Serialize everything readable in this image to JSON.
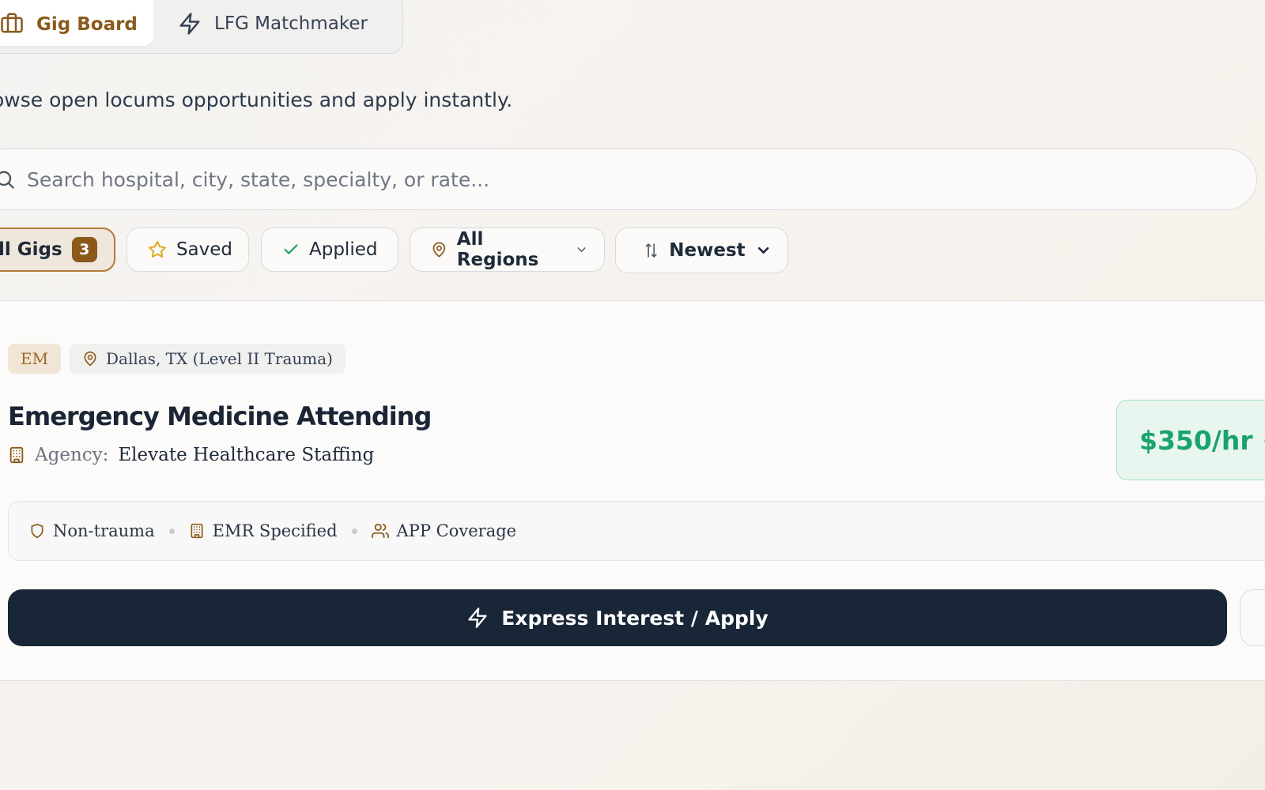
{
  "tabs": [
    {
      "label": "Gig Board",
      "icon": "briefcase-icon"
    },
    {
      "label": "LFG Matchmaker",
      "icon": "lightning-icon"
    }
  ],
  "subtitle": "owse open locums opportunities and apply instantly.",
  "search": {
    "placeholder": "Search hospital, city, state, specialty, or rate..."
  },
  "filters": {
    "all": {
      "label": "ll Gigs",
      "count": "3"
    },
    "saved": {
      "label": "Saved"
    },
    "applied": {
      "label": "Applied"
    },
    "region": {
      "label": "All Regions"
    },
    "sort": {
      "label": "Newest"
    }
  },
  "gig": {
    "specialty": "EM",
    "location": "Dallas, TX (Level II Trauma)",
    "title": "Emergency Medicine Attending",
    "agency_label": "Agency:",
    "agency": "Elevate Healthcare Staffing",
    "rate": "$350/hr +",
    "features": [
      "Non-trauma",
      "EMR Specified",
      "APP Coverage"
    ],
    "apply_label": "Express Interest / Apply"
  },
  "colors": {
    "accent": "#8b5a1b",
    "dark": "#192638",
    "rate_green": "#1aa36b"
  }
}
